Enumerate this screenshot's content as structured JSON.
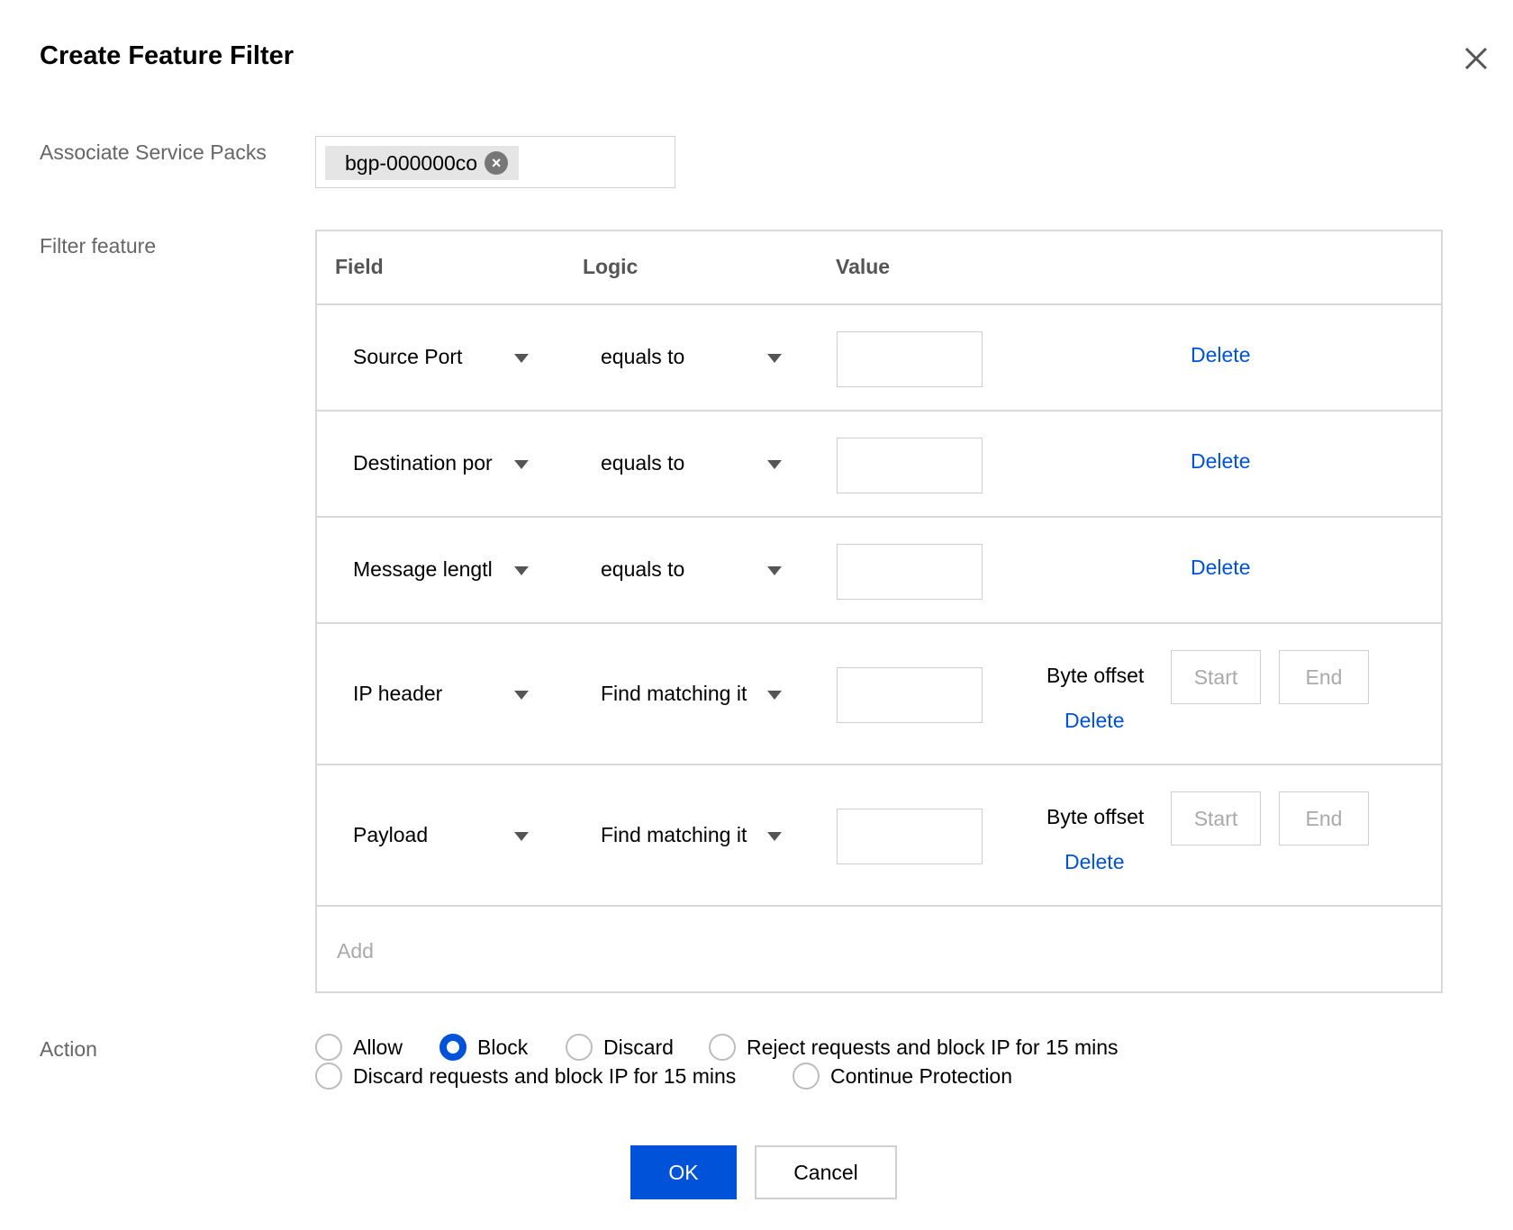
{
  "dialog": {
    "title": "Create Feature Filter",
    "close_icon": "close-icon"
  },
  "service_packs": {
    "label": "Associate Service Packs",
    "tag": "bgp-000000co"
  },
  "filter": {
    "label": "Filter feature",
    "headers": {
      "field": "Field",
      "logic": "Logic",
      "value": "Value"
    },
    "rows": [
      {
        "field": "Source Port",
        "logic": "equals to",
        "value": "",
        "delete": "Delete"
      },
      {
        "field": "Destination por",
        "logic": "equals to",
        "value": "",
        "delete": "Delete"
      },
      {
        "field": "Message lengtl",
        "logic": "equals to",
        "value": "",
        "delete": "Delete"
      },
      {
        "field": "IP header",
        "logic": "Find matching it",
        "value": "",
        "byte_offset": "Byte offset",
        "start": "Start",
        "end": "End",
        "delete": "Delete"
      },
      {
        "field": "Payload",
        "logic": "Find matching it",
        "value": "",
        "byte_offset": "Byte offset",
        "start": "Start",
        "end": "End",
        "delete": "Delete"
      }
    ],
    "add": "Add"
  },
  "action": {
    "label": "Action",
    "options": [
      {
        "label": "Allow",
        "selected": false
      },
      {
        "label": "Block",
        "selected": true
      },
      {
        "label": "Discard",
        "selected": false
      },
      {
        "label": "Reject requests and block IP for 15 mins",
        "selected": false
      },
      {
        "label": "Discard requests and block IP for 15 mins",
        "selected": false
      },
      {
        "label": "Continue Protection",
        "selected": false
      }
    ]
  },
  "buttons": {
    "ok": "OK",
    "cancel": "Cancel"
  },
  "colors": {
    "accent": "#0052d9",
    "border": "#d9d9d9",
    "label": "#666666"
  }
}
